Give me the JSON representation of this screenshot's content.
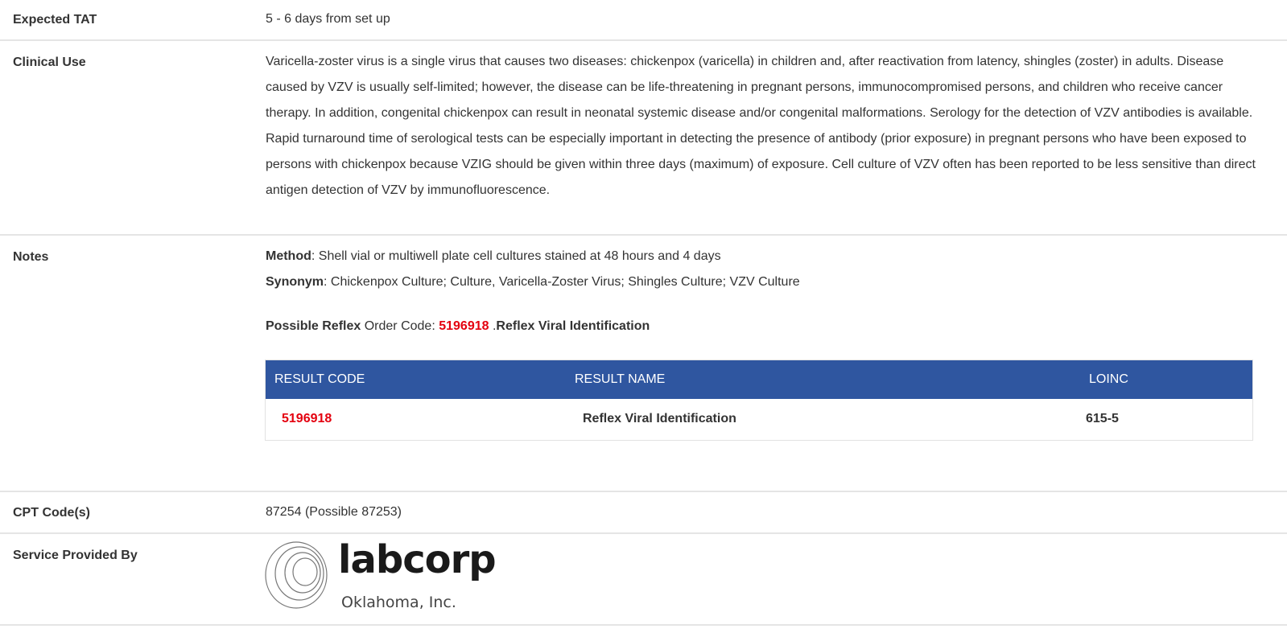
{
  "rows": {
    "tat": {
      "label": "Expected TAT",
      "value": "5 - 6 days from set up"
    },
    "clinical": {
      "label": "Clinical Use",
      "value": "Varicella-zoster virus is a single virus that causes two diseases: chickenpox (varicella) in children and, after reactivation from latency, shingles (zoster) in adults. Disease caused by VZV is usually self-limited; however, the disease can be life-threatening in pregnant persons, immunocompromised persons, and children who receive cancer therapy. In addition, congenital chickenpox can result in neonatal systemic disease and/or congenital malformations. Serology for the detection of VZV antibodies is available. Rapid turnaround time of serological tests can be especially important in detecting the presence of antibody (prior exposure) in pregnant persons who have been exposed to persons with chickenpox because VZIG should be given within three days (maximum) of exposure. Cell culture of VZV often has been reported to be less sensitive than direct antigen detection of VZV by immunofluorescence."
    },
    "notes": {
      "label": "Notes",
      "method_label": "Method",
      "method_text": ": Shell vial or multiwell plate cell cultures stained at 48 hours and 4 days",
      "synonym_label": "Synonym",
      "synonym_text": ": Chickenpox Culture; Culture, Varicella-Zoster Virus; Shingles Culture; VZV Culture",
      "reflex_label": "Possible Reflex",
      "reflex_order_text": " Order Code: ",
      "reflex_code": "5196918",
      "reflex_sep": " .",
      "reflex_name": "Reflex Viral Identification",
      "table": {
        "headers": [
          "RESULT CODE",
          "RESULT NAME",
          "LOINC"
        ],
        "rows": [
          {
            "code": "5196918",
            "name": "Reflex Viral Identification",
            "loinc": "615-5"
          }
        ]
      }
    },
    "cpt": {
      "label": "CPT Code(s)",
      "value": "87254 (Possible 87253)"
    },
    "service": {
      "label": "Service Provided By",
      "logo_word": "labcorp",
      "logo_sub": "Oklahoma, Inc."
    }
  },
  "colors": {
    "table_header": "#2f56a0",
    "accent_red": "#e4000f",
    "divider": "#e5e5e5"
  }
}
